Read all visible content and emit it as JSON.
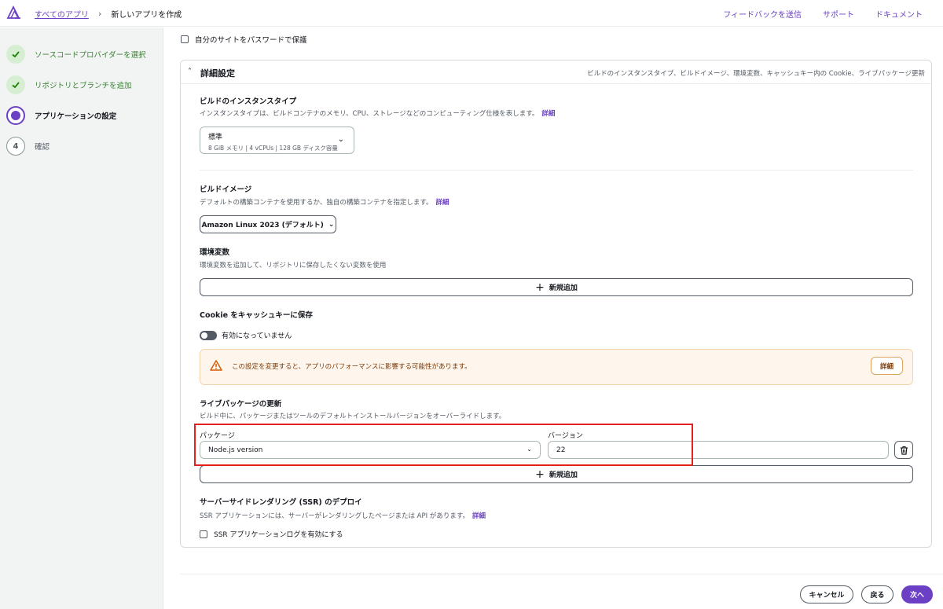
{
  "breadcrumb": {
    "all_apps": "すべてのアプリ",
    "current": "新しいアプリを作成"
  },
  "header_links": [
    "フィードバックを送信",
    "サポート",
    "ドキュメント"
  ],
  "steps": [
    {
      "label": "ソースコードプロバイダーを選択",
      "state": "done"
    },
    {
      "label": "リポジトリとブランチを追加",
      "state": "done"
    },
    {
      "label": "アプリケーションの設定",
      "state": "active"
    },
    {
      "number": "4",
      "label": "確認",
      "state": "todo"
    }
  ],
  "password_protect": {
    "label": "自分のサイトをパスワードで保護",
    "checked": false
  },
  "advanced": {
    "title": "詳細設定",
    "summary": "ビルドのインスタンスタイプ、ビルドイメージ、環境変数、キャッシュキー内の Cookie、ライブパッケージ更新",
    "instance_type": {
      "title": "ビルドのインスタンスタイプ",
      "desc": "インスタンスタイプは、ビルドコンテナのメモリ、CPU、ストレージなどのコンピューティング仕様を表します。",
      "link": "詳細",
      "selected_name": "標準",
      "selected_spec": "8 GiB メモリ | 4 vCPUs | 128 GB ディスク容量"
    },
    "build_image": {
      "title": "ビルドイメージ",
      "desc": "デフォルトの構築コンテナを使用するか、独自の構築コンテナを指定します。",
      "link": "詳細",
      "selected": "Amazon Linux 2023 (デフォルト)"
    },
    "env_vars": {
      "title": "環境変数",
      "desc": "環境変数を追加して、リポジトリに保存したくない変数を使用",
      "add_button": "新規追加"
    },
    "cookie": {
      "title": "Cookie をキャッシュキーに保存",
      "toggle_label": "有効になっていません",
      "enabled": false,
      "warning": "この設定を変更すると、アプリのパフォーマンスに影響する可能性があります。",
      "warning_button": "詳細"
    },
    "live_package": {
      "title": "ライブパッケージの更新",
      "desc": "ビルド中に、パッケージまたはツールのデフォルトインストールバージョンをオーバーライドします。",
      "package_label": "パッケージ",
      "version_label": "バージョン",
      "package_value": "Node.js version",
      "version_value": "22",
      "add_button": "新規追加"
    },
    "ssr": {
      "title": "サーバーサイドレンダリング (SSR) のデプロイ",
      "desc": "SSR アプリケーションには、サーバーがレンダリングしたページまたは API があります。",
      "link": "詳細",
      "log_label": "SSR アプリケーションログを有効にする",
      "log_checked": false
    }
  },
  "footer": {
    "cancel": "キャンセル",
    "back": "戻る",
    "next": "次へ"
  },
  "colors": {
    "accent": "#6b40c4",
    "done": "#3b7f35",
    "warning_bg": "#fef6ec",
    "highlight": "#e22020"
  }
}
